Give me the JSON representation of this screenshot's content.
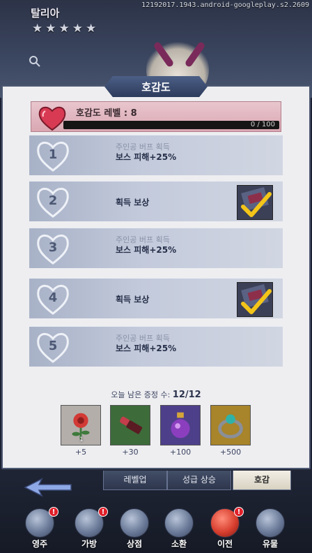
{
  "header": {
    "character_name": "탈리아",
    "stars": [
      "★",
      "★",
      "★",
      "★",
      "★"
    ],
    "version_text": "12192017.1943.android-googleplay.s2.2609"
  },
  "panel": {
    "title": "호감도",
    "level_label": "호감도 레벨 : 8",
    "progress_text": "0 / 100",
    "progress_fraction": 0,
    "rows": [
      {
        "num": "1",
        "line1": "주인공 버프 획득",
        "line2": "보스 피해+25%"
      },
      {
        "num": "2",
        "reward": "획득 보상",
        "claimed": true
      },
      {
        "num": "3",
        "line1": "주인공 버프 획득",
        "line2": "보스 피해+25%"
      },
      {
        "num": "4",
        "reward": "획득 보상",
        "claimed": true
      },
      {
        "num": "5",
        "line1": "주인공 버프 획득",
        "line2": "보스 피해+25%"
      }
    ],
    "remaining_prefix": "오늘 남은 증정 수:",
    "remaining_value": "12/12",
    "gifts": [
      {
        "icon": "red-flower-icon",
        "count": "1",
        "price": "+5",
        "bg": "#b3aeaa"
      },
      {
        "icon": "lipstick-icon",
        "count": "",
        "price": "+30",
        "bg": "#3d6b3a"
      },
      {
        "icon": "perfume-bottle-icon",
        "count": "",
        "price": "+100",
        "bg": "#4e3f8a"
      },
      {
        "icon": "gem-ring-icon",
        "count": "",
        "price": "+500",
        "bg": "#a8842a"
      }
    ]
  },
  "tabs": {
    "levelup": "레벨업",
    "star_up": "성급 상승",
    "affection": "호감"
  },
  "bottom_nav": [
    {
      "label": "영주",
      "icon": "lord-icon",
      "alert": "!"
    },
    {
      "label": "가방",
      "icon": "backpack-icon",
      "alert": "!"
    },
    {
      "label": "상점",
      "icon": "shop-icon",
      "alert": ""
    },
    {
      "label": "소환",
      "icon": "summon-orb-icon",
      "alert": ""
    },
    {
      "label": "이전",
      "icon": "return-arrow-icon",
      "alert": "!"
    },
    {
      "label": "유물",
      "icon": "relic-watch-icon",
      "alert": ""
    }
  ]
}
